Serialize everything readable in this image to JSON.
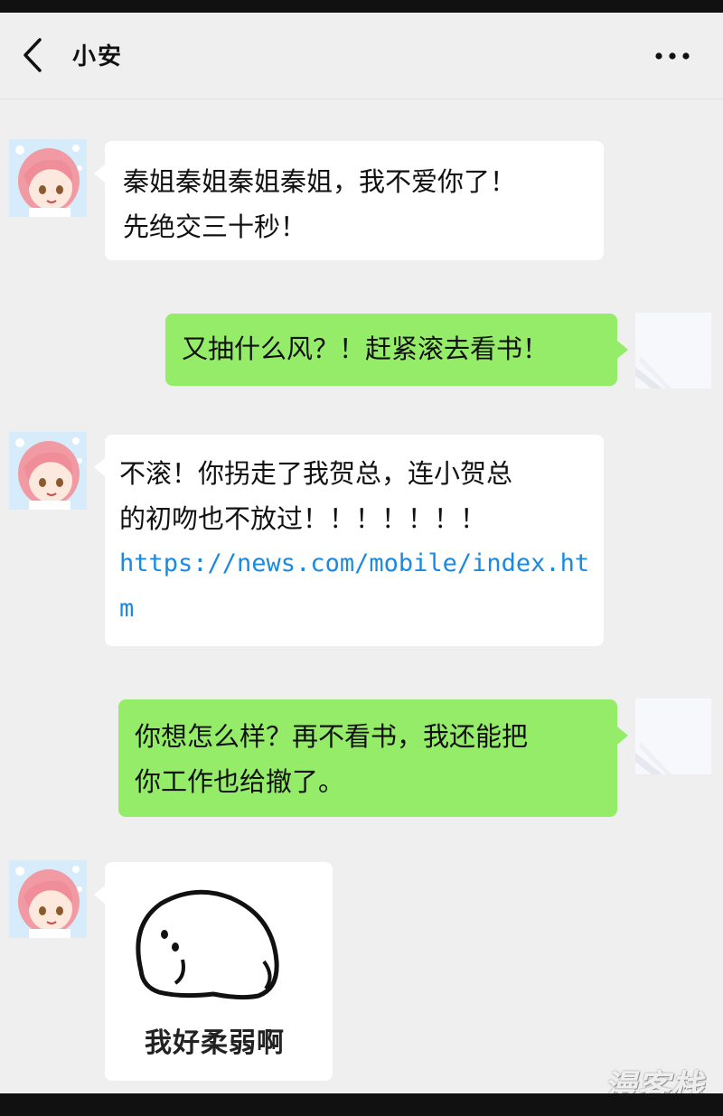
{
  "header": {
    "title": "小安",
    "back_icon": "chevron-left-icon",
    "more_icon": "more-horizontal-icon"
  },
  "messages": [
    {
      "side": "left",
      "lines": [
        "秦姐秦姐秦姐秦姐，我不爱你了！",
        "先绝交三十秒！"
      ]
    },
    {
      "side": "right",
      "lines": [
        "又抽什么风？！赶紧滚去看书！"
      ]
    },
    {
      "side": "left",
      "lines": [
        "不滚！你拐走了我贺总，连小贺总",
        "的初吻也不放过！！！！！！！"
      ],
      "link": "https://news.com/mobile/index.htm"
    },
    {
      "side": "right",
      "lines": [
        "你想怎么样？再不看书，我还能把",
        "你工作也给撤了。"
      ]
    },
    {
      "side": "left",
      "sticker_caption": "我好柔弱啊"
    }
  ],
  "watermark": "漫客栈",
  "colors": {
    "sent_bubble": "#95ec69",
    "received_bubble": "#ffffff",
    "background": "#efefef",
    "link": "#1a8ae0"
  }
}
